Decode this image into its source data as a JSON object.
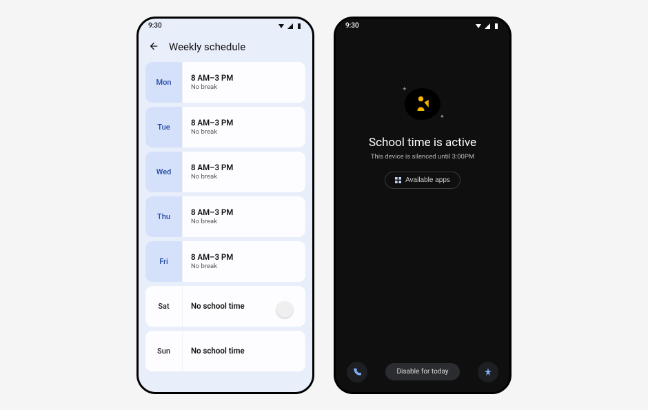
{
  "left": {
    "status_time": "9:30",
    "title": "Weekly schedule",
    "days": [
      {
        "abbr": "Mon",
        "time": "8 AM–3 PM",
        "break": "No break",
        "active": true
      },
      {
        "abbr": "Tue",
        "time": "8 AM–3 PM",
        "break": "No break",
        "active": true
      },
      {
        "abbr": "Wed",
        "time": "8 AM–3 PM",
        "break": "No break",
        "active": true
      },
      {
        "abbr": "Thu",
        "time": "8 AM–3 PM",
        "break": "No break",
        "active": true
      },
      {
        "abbr": "Fri",
        "time": "8 AM–3 PM",
        "break": "No break",
        "active": true
      },
      {
        "abbr": "Sat",
        "time": "No school time",
        "break": "",
        "active": false
      },
      {
        "abbr": "Sun",
        "time": "No school time",
        "break": "",
        "active": false
      }
    ]
  },
  "right": {
    "status_time": "9:30",
    "title": "School time is active",
    "subtitle": "This device is silenced until 3:00PM",
    "available_apps_label": "Available apps",
    "disable_label": "Disable for today"
  }
}
